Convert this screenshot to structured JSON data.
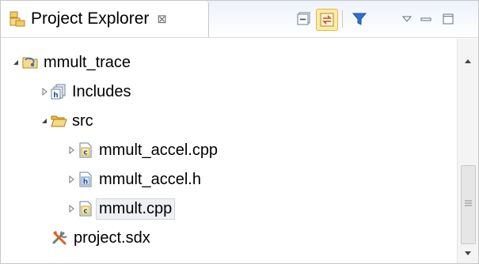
{
  "view": {
    "title": "Project Explorer",
    "close_glyph": "⊠"
  },
  "toolbar": [
    {
      "name": "collapse-all-icon"
    },
    {
      "name": "link-with-editor-icon",
      "active": true
    },
    {
      "name": "filter-icon"
    },
    {
      "name": "view-menu-icon"
    },
    {
      "name": "minimize-icon"
    },
    {
      "name": "maximize-icon"
    }
  ],
  "tree": {
    "project": {
      "label": "mmult_trace",
      "icon": "project-folder-icon",
      "expanded": true
    },
    "includes": {
      "label": "Includes",
      "icon": "includes-icon",
      "expanded": false
    },
    "src": {
      "label": "src",
      "icon": "folder-open-icon",
      "expanded": true
    },
    "files": [
      {
        "label": "mmult_accel.cpp",
        "icon": "cpp-file-icon",
        "letter": "c"
      },
      {
        "label": "mmult_accel.h",
        "icon": "header-file-icon",
        "letter": "h"
      },
      {
        "label": "mmult.cpp",
        "icon": "cpp-file-icon",
        "letter": "c",
        "selected": true
      }
    ],
    "sdx": {
      "label": "project.sdx",
      "icon": "sdx-tools-icon"
    }
  },
  "colors": {
    "filter_blue": "#2f6fd1",
    "folder_yellow": "#f1c74c",
    "selection_bg": "#eef0f4"
  }
}
